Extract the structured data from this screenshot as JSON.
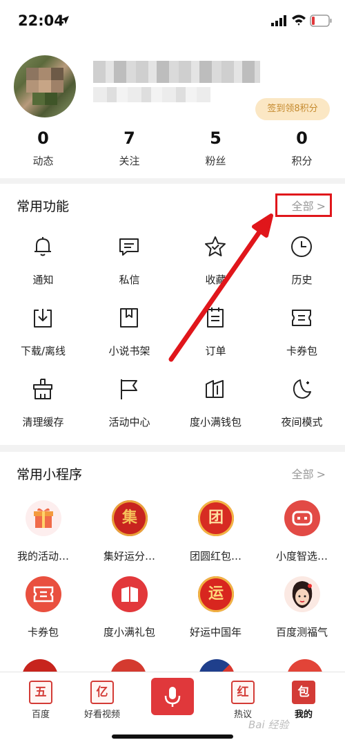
{
  "status_bar": {
    "time": "22:04"
  },
  "profile": {
    "signin_label": "签到领8积分",
    "stats": [
      {
        "value": "0",
        "label": "动态"
      },
      {
        "value": "7",
        "label": "关注"
      },
      {
        "value": "5",
        "label": "粉丝"
      },
      {
        "value": "0",
        "label": "积分"
      }
    ]
  },
  "common_functions": {
    "title": "常用功能",
    "all_label": "全部",
    "items": [
      {
        "label": "通知",
        "icon": "bell-icon"
      },
      {
        "label": "私信",
        "icon": "message-icon"
      },
      {
        "label": "收藏",
        "icon": "star-icon"
      },
      {
        "label": "历史",
        "icon": "clock-icon"
      },
      {
        "label": "下载/离线",
        "icon": "download-icon"
      },
      {
        "label": "小说书架",
        "icon": "book-icon"
      },
      {
        "label": "订单",
        "icon": "order-icon"
      },
      {
        "label": "卡券包",
        "icon": "ticket-icon"
      },
      {
        "label": "清理缓存",
        "icon": "broom-icon"
      },
      {
        "label": "活动中心",
        "icon": "flag-icon"
      },
      {
        "label": "度小满钱包",
        "icon": "wallet-icon"
      },
      {
        "label": "夜间模式",
        "icon": "moon-icon"
      }
    ]
  },
  "mini_programs": {
    "title": "常用小程序",
    "all_label": "全部",
    "items": [
      {
        "label": "我的活动…",
        "icon": "gift-icon",
        "glyph": ""
      },
      {
        "label": "集好运分…",
        "icon": "lucky-icon",
        "glyph": "集"
      },
      {
        "label": "团圆红包…",
        "icon": "reunion-icon",
        "glyph": "团"
      },
      {
        "label": "小度智选…",
        "icon": "robot-icon",
        "glyph": ""
      },
      {
        "label": "卡券包",
        "icon": "coupon-icon",
        "glyph": ""
      },
      {
        "label": "度小满礼包",
        "icon": "giftbook-icon",
        "glyph": ""
      },
      {
        "label": "好运中国年",
        "icon": "fortune-icon",
        "glyph": "运"
      },
      {
        "label": "百度测福气",
        "icon": "avatar-girl-icon",
        "glyph": ""
      }
    ]
  },
  "tab_bar": {
    "tabs": [
      {
        "label": "百度",
        "glyph": "五"
      },
      {
        "label": "好看视频",
        "glyph": "亿"
      },
      {
        "label": "热议",
        "glyph": "红"
      },
      {
        "label": "我的",
        "glyph": "包"
      }
    ]
  },
  "watermark": "Bai 经验",
  "colors": {
    "accent": "#e0383b",
    "highlight": "#e0161b",
    "signin_bg": "#fbe7c4"
  }
}
